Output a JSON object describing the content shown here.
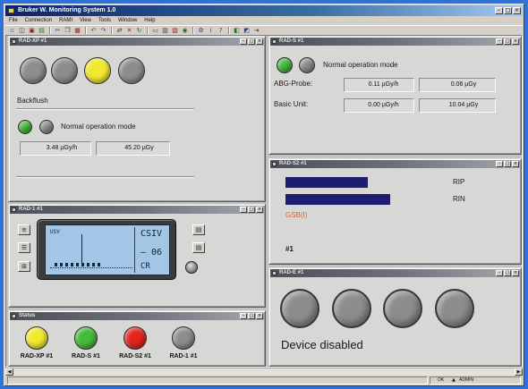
{
  "app": {
    "title": "Bruker W. Monitoring System 1.0",
    "menu": [
      "File",
      "Connection",
      "RAMI",
      "View",
      "Tools",
      "Window",
      "Help"
    ],
    "toolbar": [
      "new-icon",
      "open-icon",
      "save-icon",
      "print-icon",
      "cut-icon",
      "copy-icon",
      "paste-icon",
      "undo-icon",
      "redo-icon",
      "connect-icon",
      "disconnect-icon",
      "refresh-icon",
      "monitor-icon",
      "table-icon",
      "chart-icon",
      "alarm-icon",
      "settings-icon",
      "info-icon",
      "help-icon",
      "tile-icon",
      "cascade-icon",
      "exit-icon"
    ]
  },
  "colors": {
    "gray": "#8d8d8d",
    "yellow": "#f2e82e",
    "green": "#41bb3a",
    "red": "#e2241c",
    "bar": "#1e1e70",
    "link": "#e4622a",
    "lcd": "#a3c6e6"
  },
  "windows": {
    "main_status": {
      "title": "RAD-XP #1",
      "lamps": [
        "gray",
        "gray",
        "yellow",
        "gray"
      ],
      "mode": "Backflush",
      "status_lamps": [
        "green",
        "gray"
      ],
      "status_text": "Normal operation mode",
      "dose_rate": "3.48 µGy/h",
      "dose": "45.20 µGy"
    },
    "probe": {
      "title": "RAD-S #1",
      "status_lamps": [
        "green",
        "gray"
      ],
      "status_text": "Normal operation mode",
      "rows": [
        {
          "label": "ABG-Probe:",
          "dose_rate": "0.11 µGy/h",
          "dose": "0.06 µGy"
        },
        {
          "label": "Basic Unit:",
          "dose_rate": "0.00 µGy/h",
          "dose": "10.04 µGy"
        }
      ]
    },
    "levels": {
      "title": "RAD-S2 #1",
      "bars": [
        {
          "label": "RIP",
          "level": 0.54
        },
        {
          "label": "RIN",
          "level": 0.69
        }
      ],
      "link": "GSB(I)",
      "id": "#1"
    },
    "display": {
      "title": "RAD-1 #1",
      "graph_label": "USV",
      "readout": [
        "CSIV",
        "– 06",
        "CR"
      ],
      "left_buttons": [
        "list-icon",
        "menu-icon",
        "grid-icon"
      ],
      "right_buttons": [
        "page-icon",
        "page-icon"
      ]
    },
    "devices": {
      "title": "Status",
      "items": [
        {
          "name": "RAD-XP #1",
          "lamp": "yellow"
        },
        {
          "name": "RAD-S #1",
          "lamp": "green"
        },
        {
          "name": "RAD-S2 #1",
          "lamp": "red"
        },
        {
          "name": "RAD-1 #1",
          "lamp": "gray"
        }
      ]
    },
    "disabled": {
      "title": "RAD-E #1",
      "lamps": [
        "gray",
        "gray",
        "gray",
        "gray"
      ],
      "status_text": "Device disabled"
    }
  },
  "statusbar": {
    "state": "OK",
    "user": "ADMIN"
  }
}
